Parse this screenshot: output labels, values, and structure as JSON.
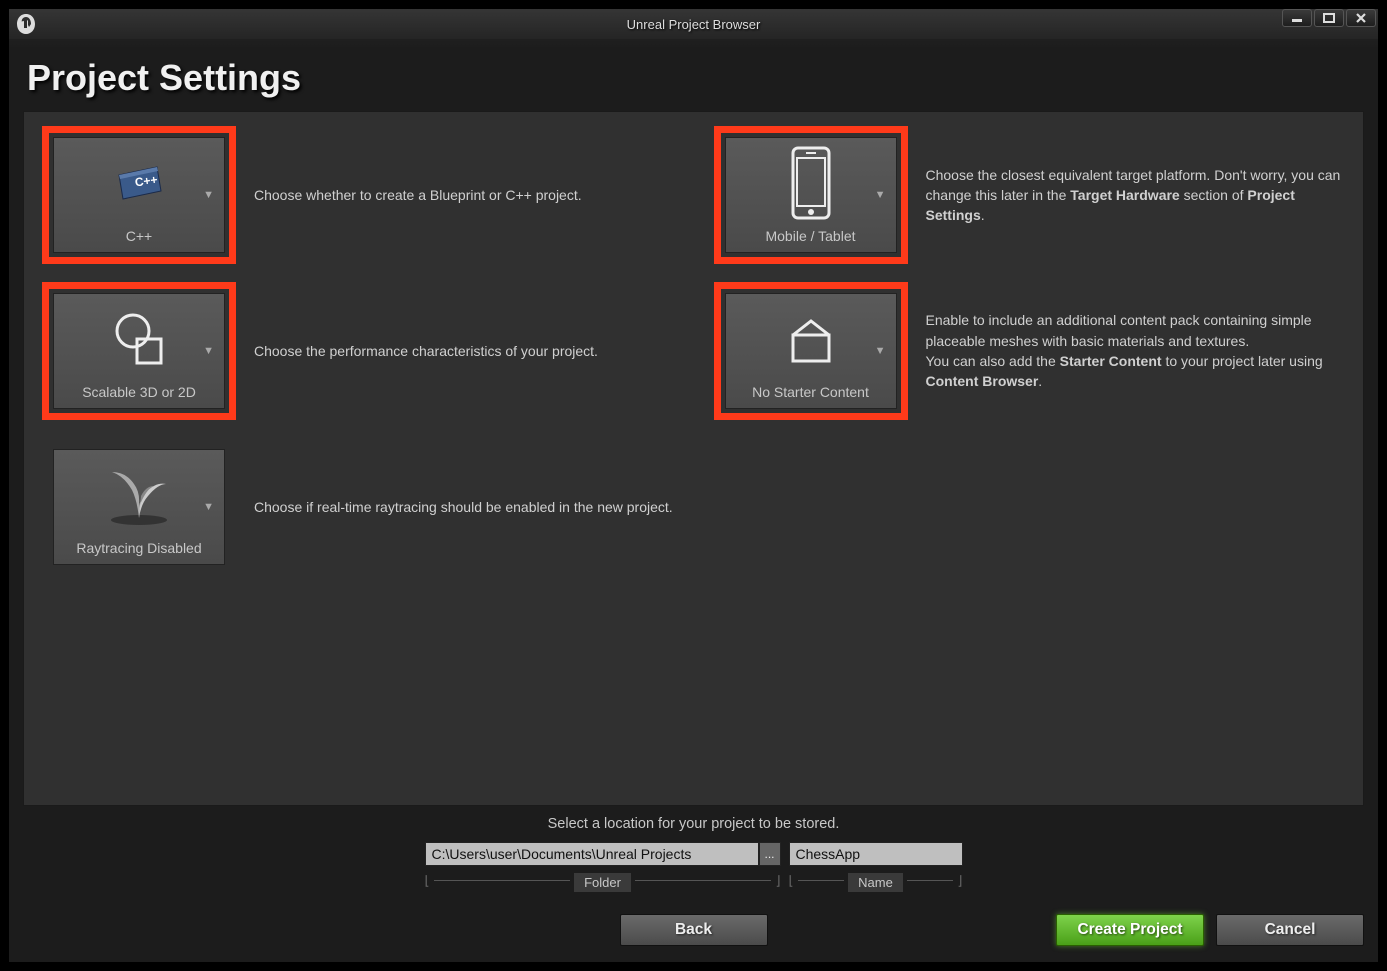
{
  "window": {
    "title": "Unreal Project Browser"
  },
  "page": {
    "title": "Project Settings"
  },
  "tiles": {
    "cpp": {
      "label": "C++",
      "desc": "Choose whether to create a Blueprint or C++ project."
    },
    "scalable": {
      "label": "Scalable 3D or 2D",
      "desc": "Choose the performance characteristics of your project."
    },
    "raytracing": {
      "label": "Raytracing Disabled",
      "desc": "Choose if real-time raytracing should be enabled in the new project."
    },
    "mobile": {
      "label": "Mobile / Tablet",
      "desc_pre": "Choose the closest equivalent target platform. Don't worry, you can change this later in the ",
      "bold1": "Target Hardware",
      "desc_mid": " section of ",
      "bold2": "Project Settings",
      "desc_end": "."
    },
    "starter": {
      "label": "No Starter Content",
      "desc_line1": "Enable to include an additional content pack containing simple placeable meshes with basic materials and textures.",
      "desc_line2a": "You can also add the ",
      "bold1": "Starter Content",
      "desc_line2b": " to your project later using ",
      "bold2": "Content Browser",
      "desc_end": "."
    }
  },
  "location": {
    "prompt_pre": "Select a ",
    "prompt_bold": "location",
    "prompt_post": " for your project to be stored.",
    "folder_value": "C:\\Users\\user\\Documents\\Unreal Projects",
    "name_value": "ChessApp",
    "folder_label": "Folder",
    "name_label": "Name",
    "browse": "..."
  },
  "buttons": {
    "back": "Back",
    "create": "Create Project",
    "cancel": "Cancel"
  }
}
